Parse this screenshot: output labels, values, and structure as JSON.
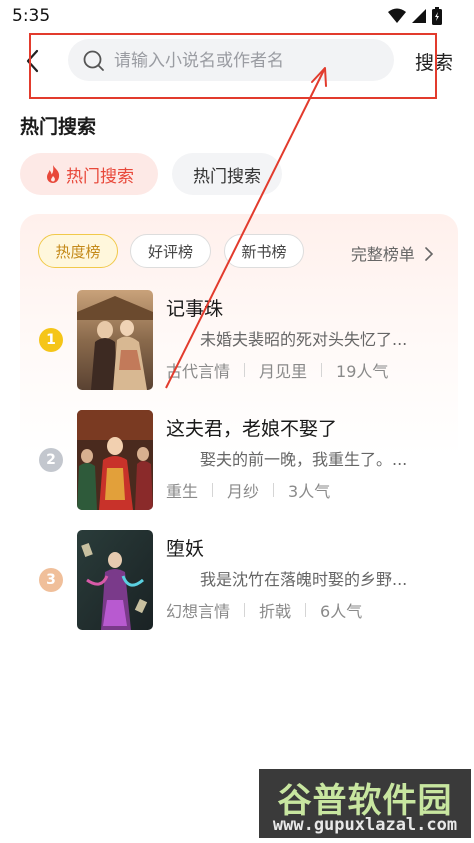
{
  "status_bar": {
    "time": "5:35"
  },
  "search": {
    "placeholder": "请输入小说名或作者名",
    "value": "",
    "submit_label": "搜索"
  },
  "hot_section": {
    "title": "热门搜索",
    "chips": [
      "热门搜索",
      "热门搜索"
    ]
  },
  "ranking": {
    "tabs": [
      "热度榜",
      "好评榜",
      "新书榜"
    ],
    "more_label": "完整榜单",
    "books": [
      {
        "rank": "1",
        "title": "记事珠",
        "desc": "未婚夫裴昭的死对头失忆了...",
        "genre": "古代言情",
        "author": "月见里",
        "popularity": "19人气"
      },
      {
        "rank": "2",
        "title": "这夫君，老娘不娶了",
        "desc": "娶夫的前一晚，我重生了。...",
        "genre": "重生",
        "author": "月纱",
        "popularity": "3人气"
      },
      {
        "rank": "3",
        "title": "堕妖",
        "desc": "我是沈竹在落魄时娶的乡野...",
        "genre": "幻想言情",
        "author": "折戟",
        "popularity": "6人气"
      }
    ]
  },
  "watermark": {
    "logo": "谷普软件园",
    "url": "www.gupuxlazal.com"
  },
  "colors": {
    "accent_red": "#e8483a",
    "rank1": "#f5c518",
    "rank2": "#c3c7ce",
    "rank3": "#f0bf9a",
    "annotation": "#e23b2d"
  },
  "icons": [
    "wifi-icon",
    "signal-icon",
    "battery-icon",
    "back-icon",
    "search-icon",
    "fire-icon",
    "chevron-right-icon"
  ]
}
